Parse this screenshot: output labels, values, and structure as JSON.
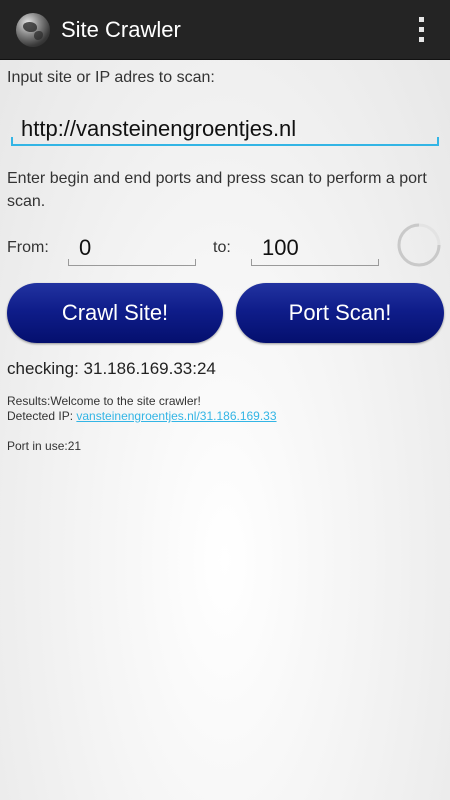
{
  "app": {
    "title": "Site Crawler",
    "icon": "globe-icon",
    "menu_icon": "overflow-menu-icon"
  },
  "form": {
    "site_label": "Input site or IP adres to scan:",
    "site_value": "http://vansteinengroentjes.nl",
    "instructions": "Enter begin and end ports and press scan to perform a port scan.",
    "from_label": "From:",
    "from_value": "0",
    "to_label": "to:",
    "to_value": "100"
  },
  "buttons": {
    "crawl_label": "Crawl Site!",
    "port_scan_label": "Port Scan!"
  },
  "status": {
    "checking": "checking: 31.186.169.33:24",
    "results": "Results:Welcome to the site crawler!",
    "detected_label": "Detected IP: ",
    "detected_value": "vansteinengroentjes.nl/31.186.169.33",
    "port_in_use": "Port in use:21"
  },
  "colors": {
    "accent": "#33b5e5",
    "button": "#0f1d8a",
    "actionbar": "#242424"
  }
}
